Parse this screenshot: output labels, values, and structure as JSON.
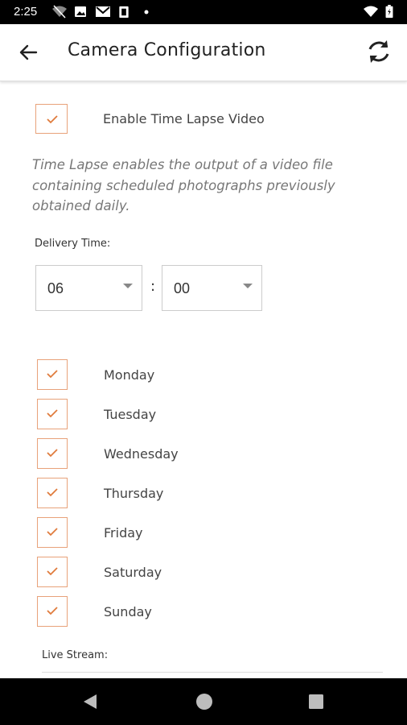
{
  "status_bar": {
    "time": "2:25",
    "icons": [
      "wifi-off-icon",
      "image-icon",
      "gmail-icon",
      "clipboard-icon",
      "dot-icon",
      "wifi-icon",
      "battery-icon"
    ]
  },
  "app_bar": {
    "title": "Camera Configuration",
    "back_icon": "arrow-left-icon",
    "sync_icon": "sync-icon"
  },
  "time_lapse": {
    "label": "Enable Time Lapse Video",
    "checked": true,
    "description": "Time Lapse enables the output of a video file containing scheduled photographs previously obtained daily."
  },
  "delivery_time": {
    "label": "Delivery Time:",
    "hour": "06",
    "separator": ":",
    "minute": "00"
  },
  "days": [
    {
      "label": "Monday",
      "checked": true
    },
    {
      "label": "Tuesday",
      "checked": true
    },
    {
      "label": "Wednesday",
      "checked": true
    },
    {
      "label": "Thursday",
      "checked": true
    },
    {
      "label": "Friday",
      "checked": true
    },
    {
      "label": "Saturday",
      "checked": true
    },
    {
      "label": "Sunday",
      "checked": true
    }
  ],
  "live_stream": {
    "label": "Live Stream:"
  },
  "nav_bar": {
    "icons": [
      "back-triangle-icon",
      "home-circle-icon",
      "recents-square-icon"
    ]
  },
  "colors": {
    "accent": "#e8a27a",
    "check": "#e07b3c"
  }
}
